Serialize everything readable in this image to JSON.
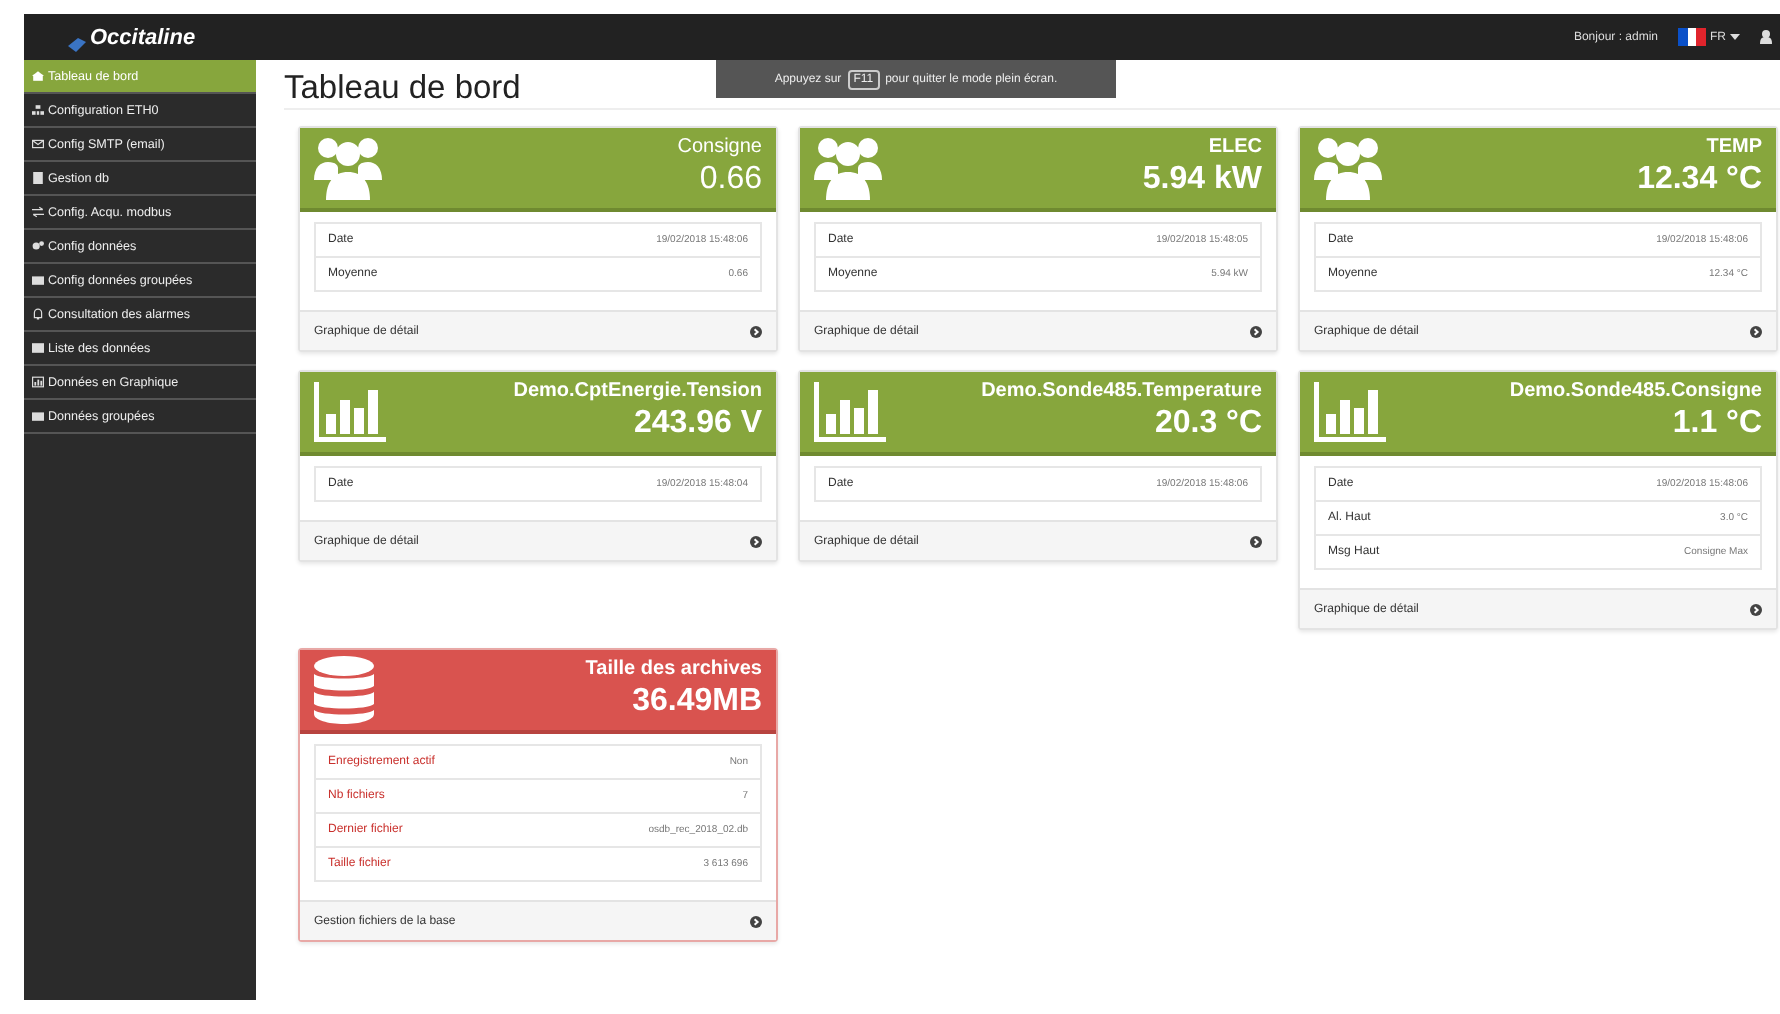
{
  "topbar": {
    "logo": "Occitaline",
    "greeting": "Bonjour : admin",
    "language": "FR"
  },
  "fullscreen_notice": {
    "before": "Appuyez sur",
    "key": "F11",
    "after": "pour quitter le mode plein écran."
  },
  "sidebar": {
    "items": [
      {
        "label": "Tableau de bord",
        "selected": true
      },
      {
        "label": "Configuration ETH0",
        "selected": false
      },
      {
        "label": "Config SMTP (email)",
        "selected": false
      },
      {
        "label": "Gestion db",
        "selected": false
      },
      {
        "label": "Config. Acqu. modbus",
        "selected": false
      },
      {
        "label": "Config données",
        "selected": false
      },
      {
        "label": "Config données groupées",
        "selected": false
      },
      {
        "label": "Consultation des alarmes",
        "selected": false
      },
      {
        "label": "Liste des données",
        "selected": false
      },
      {
        "label": "Données en Graphique",
        "selected": false
      },
      {
        "label": "Données groupées",
        "selected": false
      }
    ]
  },
  "page_title": "Tableau de bord",
  "cards": [
    {
      "kind": "group",
      "name": "Consigne",
      "value": "0.66",
      "rows": [
        {
          "label": "Date",
          "value": "19/02/2018 15:48:06"
        },
        {
          "label": "Moyenne",
          "value": "0.66"
        }
      ],
      "footer": "Graphique de détail"
    },
    {
      "kind": "group",
      "name": "ELEC",
      "value": "5.94 kW",
      "rows": [
        {
          "label": "Date",
          "value": "19/02/2018 15:48:05"
        },
        {
          "label": "Moyenne",
          "value": "5.94 kW"
        }
      ],
      "footer": "Graphique de détail"
    },
    {
      "kind": "group",
      "name": "TEMP",
      "value": "12.34 °C",
      "rows": [
        {
          "label": "Date",
          "value": "19/02/2018 15:48:06"
        },
        {
          "label": "Moyenne",
          "value": "12.34 °C"
        }
      ],
      "footer": "Graphique de détail"
    },
    {
      "kind": "graph",
      "name": "Demo.CptEnergie.Tension",
      "value": "243.96 V",
      "rows": [
        {
          "label": "Date",
          "value": "19/02/2018 15:48:04"
        }
      ],
      "footer": "Graphique de détail"
    },
    {
      "kind": "graph",
      "name": "Demo.Sonde485.Temperature",
      "value": "20.3 °C",
      "rows": [
        {
          "label": "Date",
          "value": "19/02/2018 15:48:06"
        }
      ],
      "footer": "Graphique de détail"
    },
    {
      "kind": "graph",
      "name": "Demo.Sonde485.Consigne",
      "value": "1.1 °C",
      "rows": [
        {
          "label": "Date",
          "value": "19/02/2018 15:48:06"
        },
        {
          "label": "Al. Haut",
          "value": "3.0 °C"
        },
        {
          "label": "Msg Haut",
          "value": "Consigne Max"
        }
      ],
      "footer": "Graphique de détail"
    },
    {
      "kind": "storage",
      "name": "Taille des archives",
      "value": "36.49MB",
      "rows": [
        {
          "label": "Enregistrement actif",
          "value": "Non"
        },
        {
          "label": "Nb fichiers",
          "value": "7"
        },
        {
          "label": "Dernier fichier",
          "value": "osdb_rec_2018_02.db"
        },
        {
          "label": "Taille fichier",
          "value": "3 613 696"
        }
      ],
      "footer": "Gestion fichiers de la base"
    }
  ]
}
